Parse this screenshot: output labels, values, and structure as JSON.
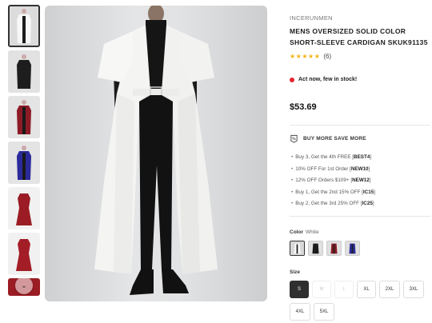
{
  "product": {
    "brand": "INCERUNMEN",
    "title": "MENS OVERSIZED SOLID COLOR SHORT-SLEEVE CARDIGAN SKUK91135",
    "rating_stars": "★★★★★",
    "review_count": "(6)",
    "stock_notice": "Act now, few in stock!",
    "price": "$53.69"
  },
  "promo": {
    "heading": "BUY MORE SAVE MORE",
    "items": [
      {
        "text": "Buy 3, Get the 4th FREE [",
        "code": "BEST4",
        "end": "]"
      },
      {
        "text": "10% OFF For 1st Order [",
        "code": "NEW10",
        "end": "]"
      },
      {
        "text": "12% OFF Orders $109+ [",
        "code": "NEW12",
        "end": "]"
      },
      {
        "text": "Buy 1, Get the 2nd 15% OFF [",
        "code": "IC15",
        "end": "]"
      },
      {
        "text": "Buy 2, Get the 3rd 25% OFF [",
        "code": "IC25",
        "end": "]"
      }
    ]
  },
  "color": {
    "label": "Color",
    "selected": "White",
    "swatches": [
      "White",
      "Black",
      "Red",
      "Blue"
    ]
  },
  "size": {
    "label": "Size",
    "options": [
      "S",
      "M",
      "L",
      "XL",
      "2XL",
      "3XL",
      "4XL",
      "5XL"
    ],
    "selected": "S",
    "disabled": [
      "M",
      "L"
    ]
  },
  "colors": {
    "accent_red": "#e8242e",
    "star": "#f2b411",
    "selected_size": "#2f2f2f"
  }
}
